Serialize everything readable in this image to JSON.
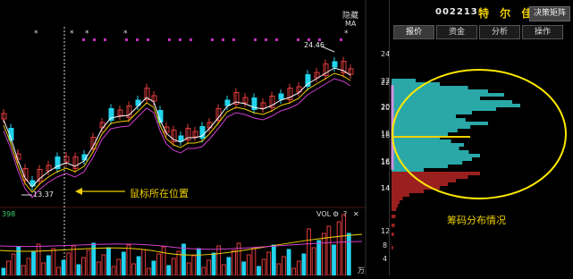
{
  "header": {
    "hide_label": "隐藏",
    "code": "002213",
    "name": "特 尔 佳",
    "decision_button": "决策矩阵"
  },
  "tabs": [
    {
      "label": "报价",
      "active": true
    },
    {
      "label": "资金",
      "active": false
    },
    {
      "label": "分析",
      "active": false
    },
    {
      "label": "操作",
      "active": false
    }
  ],
  "chart": {
    "ma_label": "MA",
    "high_marker": "24.46",
    "low_marker": "13.37",
    "cursor_annotation": "鼠标所在位置",
    "price_ticks": [
      "24",
      "22",
      "20",
      "18",
      "16",
      "14"
    ],
    "volume_label": "VOL",
    "volume_value": "398",
    "volume_ticks": [
      "12",
      "8",
      "4"
    ],
    "volume_unit": "万",
    "volume_tools": [
      "⚙",
      "?",
      "✕"
    ]
  },
  "chip_panel": {
    "ticks": [
      "22",
      "20",
      "18",
      "16",
      "14"
    ],
    "annotation": "筹码分布情况"
  },
  "colors": {
    "up": "#e23b3b",
    "down": "#22d3ee",
    "chip_upper": "#2aa8a8",
    "chip_lower": "#9a2020",
    "ellipse": "#ffe800",
    "marker": "#c030c0"
  }
}
